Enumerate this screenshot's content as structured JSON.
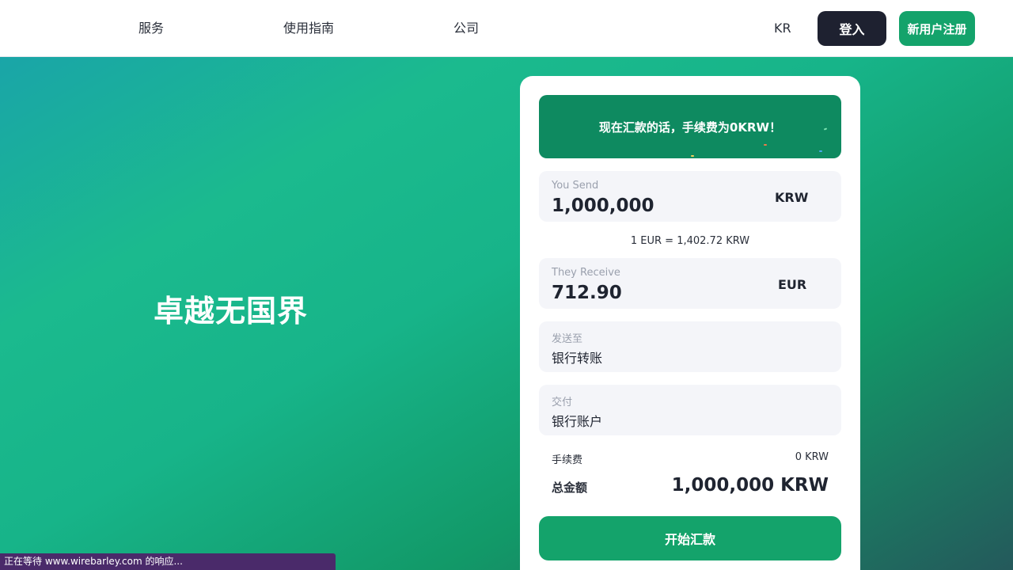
{
  "nav": {
    "links": [
      "服务",
      "使用指南",
      "公司"
    ],
    "lang": "KR",
    "login_label": "登入",
    "signup_label": "新用户注册"
  },
  "hero": {
    "title": "卓越无国界"
  },
  "card": {
    "promo_text": "现在汇款的话，手续费为0KRW！",
    "send": {
      "label": "You Send",
      "amount": "1,000,000",
      "currency": "KRW"
    },
    "rate_text": "1 EUR = 1,402.72 KRW",
    "receive": {
      "label": "They Receive",
      "amount": "712.90",
      "currency": "EUR"
    },
    "send_to": {
      "label": "发送至",
      "value": "银行转账"
    },
    "delivery": {
      "label": "交付",
      "value": "银行账户"
    },
    "fee": {
      "label": "手续费",
      "value": "0 KRW"
    },
    "total": {
      "label": "总金额",
      "value": "1,000,000 KRW"
    },
    "start_label": "开始汇款"
  },
  "status_bar": {
    "text": "正在等待 www.wirebarley.com 的响应..."
  },
  "colors": {
    "brand_green": "#14a36b",
    "dark": "#1e2130",
    "promo_bg": "#0e8a60"
  }
}
